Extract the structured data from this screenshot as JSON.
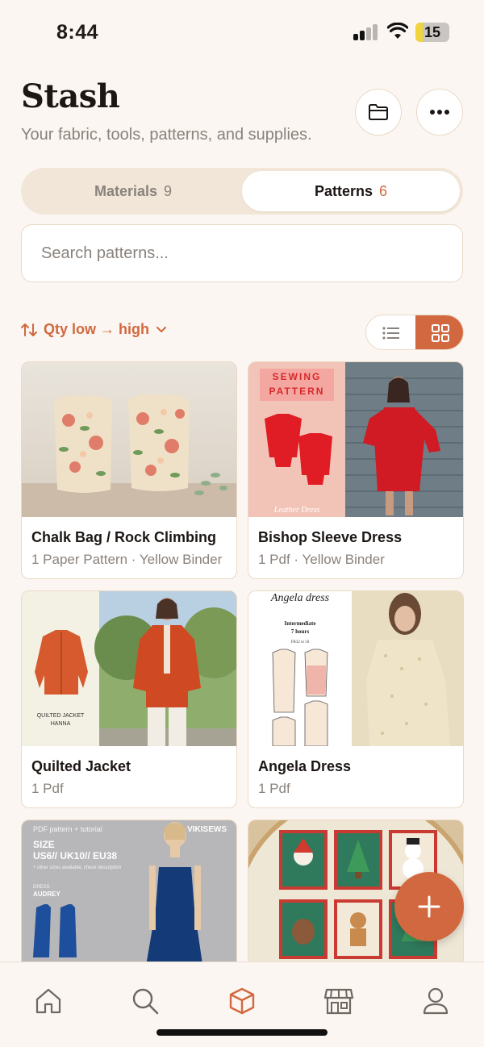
{
  "status_bar": {
    "time": "8:44",
    "battery": "15"
  },
  "header": {
    "title": "Stash",
    "subtitle": "Your fabric, tools, patterns, and supplies."
  },
  "segments": {
    "materials_label": "Materials",
    "materials_count": "9",
    "patterns_label": "Patterns",
    "patterns_count": "6"
  },
  "search": {
    "placeholder": "Search patterns..."
  },
  "sort": {
    "label": "Qty low → high"
  },
  "cards": [
    {
      "title": "Chalk Bag / Rock Climbing",
      "meta": "1 Paper Pattern · Yellow Binder"
    },
    {
      "title": "Bishop Sleeve Dress",
      "meta": "1 Pdf · Yellow Binder",
      "thumb_text": [
        "SEWING",
        "PATTERN",
        "Leather Dress"
      ]
    },
    {
      "title": "Quilted Jacket",
      "meta": "1 Pdf",
      "thumb_text": [
        "QUILTED JACKET",
        "HANNA"
      ]
    },
    {
      "title": "Angela Dress",
      "meta": "1 Pdf",
      "thumb_text": [
        "Angela dress",
        "Intermediate",
        "7 hours",
        "FR32 to 50"
      ]
    },
    {
      "title": "",
      "meta": "",
      "thumb_text": [
        "PDF pattern + tutorial",
        "VIKISEWS",
        "SIZE",
        "US6// UK10// EU38",
        "+ other sizes available, check description",
        "DRESS",
        "AUDREY"
      ]
    },
    {
      "title": "",
      "meta": ""
    }
  ],
  "colors": {
    "accent": "#d2683f",
    "background": "#fbf6f1",
    "border": "#ead9c6",
    "muted": "#8a827c"
  },
  "icons": {
    "header": [
      "folder-icon",
      "more-icon"
    ],
    "view_toggle": [
      "list-view-icon",
      "grid-view-icon"
    ],
    "tabs": [
      "home-icon",
      "search-icon",
      "stash-box-icon",
      "shop-icon",
      "profile-icon"
    ],
    "fab": "plus-icon"
  }
}
